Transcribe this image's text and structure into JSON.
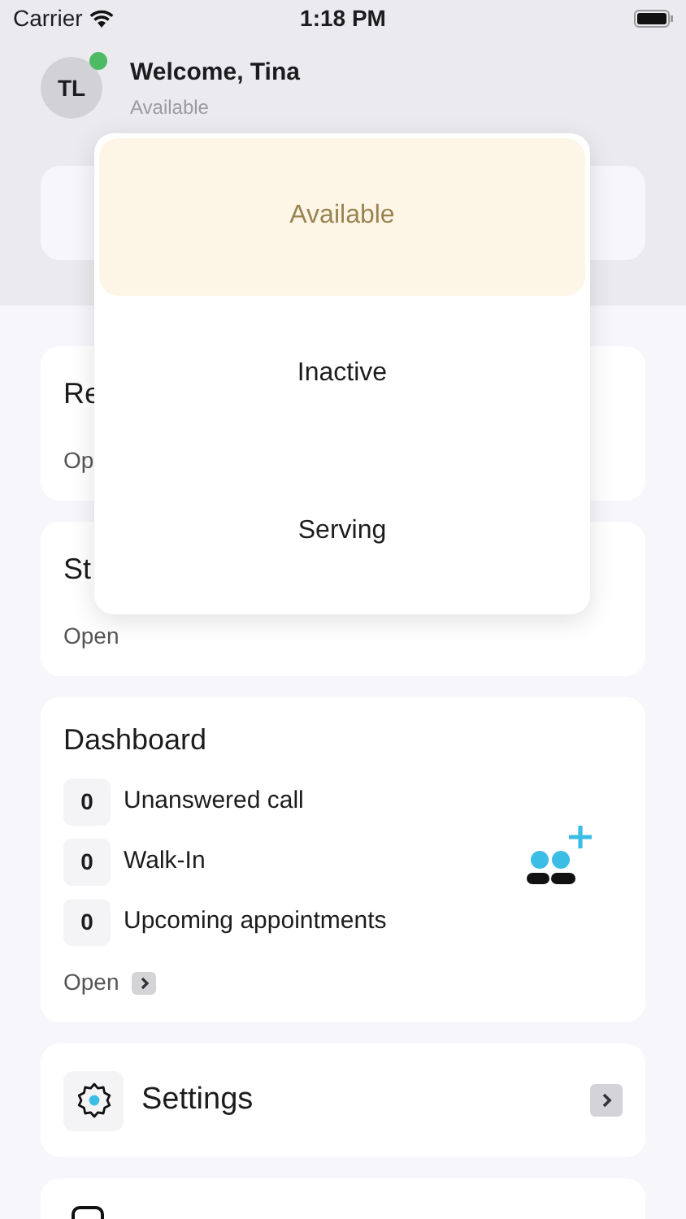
{
  "status_bar": {
    "carrier": "Carrier",
    "time": "1:18 PM"
  },
  "header": {
    "initials": "TL",
    "online": true,
    "greeting": "Welcome, Tina",
    "status": "Available"
  },
  "status_menu": [
    {
      "label": "Available",
      "selected": true
    },
    {
      "label": "Inactive",
      "selected": false
    },
    {
      "label": "Serving",
      "selected": false
    }
  ],
  "cards": [
    {
      "title": "Re",
      "link": "Op"
    },
    {
      "title": "St",
      "link": "Open"
    }
  ],
  "dashboard": {
    "title": "Dashboard",
    "rows": [
      {
        "count": "0",
        "label": "Unanswered call"
      },
      {
        "count": "0",
        "label": "Walk-In"
      },
      {
        "count": "0",
        "label": "Upcoming appointments"
      }
    ],
    "link": "Open"
  },
  "settings": {
    "label": "Settings"
  }
}
